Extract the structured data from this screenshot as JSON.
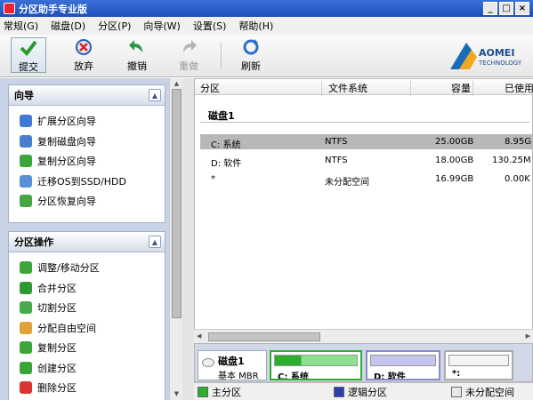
{
  "window": {
    "title": "分区助手专业版"
  },
  "menu": [
    "常规(G)",
    "磁盘(D)",
    "分区(P)",
    "向导(W)",
    "设置(S)",
    "帮助(H)"
  ],
  "toolbar": {
    "commit": "提交",
    "discard": "放弃",
    "undo": "撤销",
    "redo": "重做",
    "refresh": "刷新"
  },
  "brand": {
    "name": "AOMEI",
    "tagline": "TECHNOLOGY"
  },
  "wizard_panel": {
    "title": "向导",
    "items": [
      "扩展分区向导",
      "复制磁盘向导",
      "复制分区向导",
      "迁移OS到SSD/HDD",
      "分区恢复向导"
    ]
  },
  "ops_panel": {
    "title": "分区操作",
    "items": [
      "调整/移动分区",
      "合并分区",
      "切割分区",
      "分配自由空间",
      "复制分区",
      "创建分区",
      "删除分区"
    ]
  },
  "table": {
    "columns": [
      "分区",
      "文件系统",
      "容量",
      "已使用"
    ],
    "disk_label": "磁盘1",
    "rows": [
      {
        "partition": "C: 系统",
        "fs": "NTFS",
        "capacity": "25.00GB",
        "used": "8.95G"
      },
      {
        "partition": "D: 软件",
        "fs": "NTFS",
        "capacity": "18.00GB",
        "used": "130.25M"
      },
      {
        "partition": "*",
        "fs": "未分配空间",
        "capacity": "16.99GB",
        "used": "0.00K"
      }
    ]
  },
  "disk_map": {
    "disk": "磁盘1",
    "type": "基本 MBR",
    "c_label": "C: 系统",
    "d_label": "D: 软件",
    "u_label": "*:"
  },
  "legend": {
    "primary": "主分区",
    "logical": "逻辑分区",
    "unallocated": "未分配空间"
  },
  "colors": {
    "primary": "#2eae2e",
    "logical": "#2d3db0",
    "unallocated": "#e8e8e8",
    "accent": "#1f4fb8"
  }
}
